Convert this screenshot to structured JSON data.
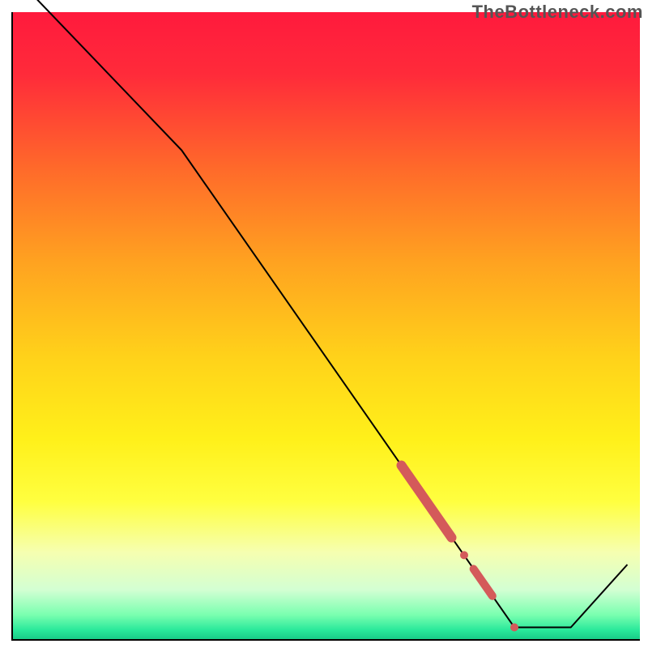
{
  "watermark": "TheBottleneck.com",
  "chart_data": {
    "type": "line",
    "title": "",
    "xlabel": "",
    "ylabel": "",
    "xlim": [
      0,
      100
    ],
    "ylim": [
      0,
      100
    ],
    "grid": false,
    "legend": false,
    "background": {
      "kind": "vertical-gradient",
      "stops": [
        {
          "offset": 0.0,
          "color": "#ff1a3d"
        },
        {
          "offset": 0.1,
          "color": "#ff2b3a"
        },
        {
          "offset": 0.25,
          "color": "#ff6a2a"
        },
        {
          "offset": 0.4,
          "color": "#ffa320"
        },
        {
          "offset": 0.55,
          "color": "#ffd21a"
        },
        {
          "offset": 0.68,
          "color": "#fff01a"
        },
        {
          "offset": 0.78,
          "color": "#ffff40"
        },
        {
          "offset": 0.86,
          "color": "#f6ffb0"
        },
        {
          "offset": 0.92,
          "color": "#d3ffd3"
        },
        {
          "offset": 0.96,
          "color": "#7affb0"
        },
        {
          "offset": 0.985,
          "color": "#28e89a"
        },
        {
          "offset": 1.0,
          "color": "#18c986"
        }
      ]
    },
    "series": [
      {
        "name": "bottleneck-curve",
        "color": "#000000",
        "width": 2,
        "points": [
          {
            "x": 4,
            "y": 102
          },
          {
            "x": 27,
            "y": 78
          },
          {
            "x": 80,
            "y": 2
          },
          {
            "x": 89,
            "y": 2
          },
          {
            "x": 98,
            "y": 12
          }
        ]
      }
    ],
    "markers": {
      "comment": "highlighted segments and dots along the curve, drawn as thick red overlays",
      "color": "#d45a5a",
      "items": [
        {
          "type": "segment",
          "x1": 62,
          "y1": 27.8,
          "x2": 70,
          "y2": 16.3,
          "width": 12,
          "cap": "round"
        },
        {
          "type": "dot",
          "x": 72,
          "y": 13.5,
          "r": 5
        },
        {
          "type": "segment",
          "x1": 73.5,
          "y1": 11.3,
          "x2": 76.5,
          "y2": 7.0,
          "width": 10,
          "cap": "round"
        },
        {
          "type": "dot",
          "x": 80,
          "y": 2.0,
          "r": 5
        }
      ]
    }
  }
}
